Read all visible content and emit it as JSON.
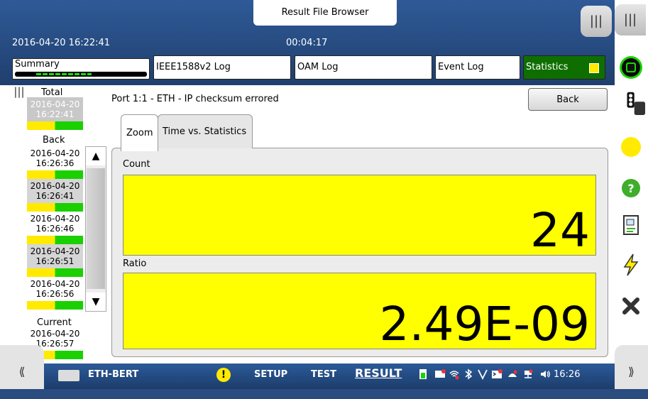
{
  "header": {
    "window_title": "Result File Browser",
    "datetime": "2016-04-20 16:22:41",
    "elapsed": "00:04:17",
    "buttons": {
      "summary": "Summary",
      "ieee_log": "IEEE1588v2 Log",
      "oam_log": "OAM Log",
      "event_log": "Event Log",
      "statistics": "Statistics"
    },
    "grip_icon": "|||"
  },
  "left_panel": {
    "grip_icon": "|||",
    "total_label": "Total",
    "total_time": "2016-04-20\n16:22:41",
    "back_label": "Back",
    "history": [
      {
        "date": "2016-04-20",
        "time": "16:26:36"
      },
      {
        "date": "2016-04-20",
        "time": "16:26:41"
      },
      {
        "date": "2016-04-20",
        "time": "16:26:46"
      },
      {
        "date": "2016-04-20",
        "time": "16:26:51"
      },
      {
        "date": "2016-04-20",
        "time": "16:26:56"
      }
    ],
    "current_label": "Current",
    "current": {
      "date": "2016-04-20",
      "time": "16:26:57"
    },
    "scroll_up": "▲",
    "scroll_down": "▼"
  },
  "main": {
    "port_label": "Port 1:1 - ETH - IP checksum errored",
    "back_button": "Back",
    "tabs": [
      "Zoom",
      "Time vs. Statistics"
    ],
    "count_label": "Count",
    "count_value": "24",
    "ratio_label": "Ratio",
    "ratio_value": "2.49E-09"
  },
  "footer": {
    "left_grip": "⟪",
    "right_grip": "⟫",
    "app_name": "ETH-BERT",
    "warning": "!",
    "setup": "SETUP",
    "test": "TEST",
    "result": "RESULT",
    "time": "16:26"
  },
  "colors": {
    "accent_blue": "#2b4c7e",
    "status_green": "#1ad000",
    "status_yellow": "#ffea00",
    "value_bg": "#ffff00"
  }
}
